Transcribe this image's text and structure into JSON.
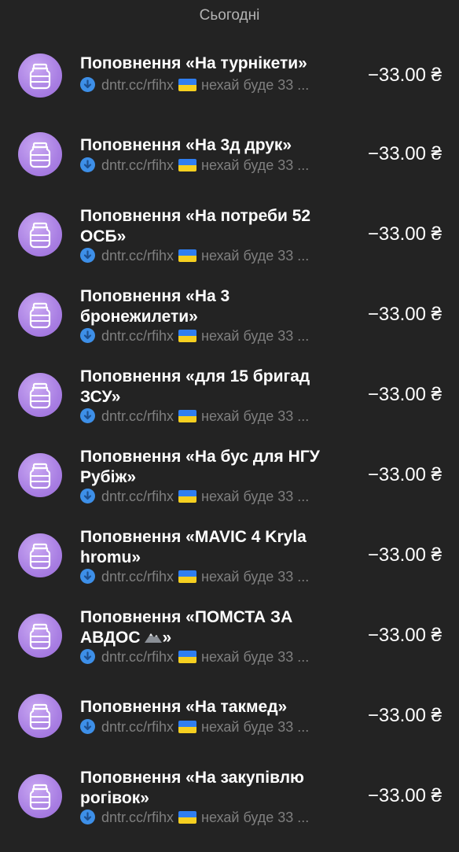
{
  "section": {
    "title": "Сьогодні"
  },
  "colors": {
    "background": "#232323",
    "avatar": "#a97fe3",
    "link_icon": "#3d8fe8",
    "flag_blue": "#2f7ef0",
    "flag_yellow": "#f5cf20"
  },
  "transactions": [
    {
      "title": "Поповнення «На турнікети»",
      "link": "dntr.cc/rfihx",
      "note": "нехай буде 33 ...",
      "amount": "−33.00 ₴",
      "icon": "jar-icon"
    },
    {
      "title": "Поповнення «На 3д друк»",
      "link": "dntr.cc/rfihx",
      "note": "нехай буде 33 ...",
      "amount": "−33.00 ₴",
      "icon": "jar-icon"
    },
    {
      "title_line1": "Поповнення «На потреби 52",
      "title_line2": "ОСБ»",
      "link": "dntr.cc/rfihx",
      "note": "нехай буде 33 ...",
      "amount": "−33.00 ₴",
      "icon": "jar-icon"
    },
    {
      "title_line1": "Поповнення «На 3",
      "title_line2": "бронежилети»",
      "link": "dntr.cc/rfihx",
      "note": "нехай буде 33 ...",
      "amount": "−33.00 ₴",
      "icon": "jar-icon"
    },
    {
      "title_line1": "Поповнення «для 15 бригад",
      "title_line2": "ЗСУ»",
      "link": "dntr.cc/rfihx",
      "note": "нехай буде 33 ...",
      "amount": "−33.00 ₴",
      "icon": "jar-icon"
    },
    {
      "title_line1": "Поповнення «На бус для НГУ",
      "title_line2": "Рубіж»",
      "link": "dntr.cc/rfihx",
      "note": "нехай буде 33 ...",
      "amount": "−33.00 ₴",
      "icon": "jar-icon"
    },
    {
      "title_line1": "Поповнення «MAVIC 4 Kryla",
      "title_line2": "hromu»",
      "link": "dntr.cc/rfihx",
      "note": "нехай буде 33 ...",
      "amount": "−33.00 ₴",
      "icon": "jar-icon"
    },
    {
      "title_line1": "Поповнення «ПОМСТА ЗА",
      "title_line2_a": "АВДОС",
      "title_line2_b": "»",
      "title_emoji": "mountain-icon",
      "link": "dntr.cc/rfihx",
      "note": "нехай буде 33 ...",
      "amount": "−33.00 ₴",
      "icon": "jar-icon"
    },
    {
      "title": "Поповнення «На такмед»",
      "link": "dntr.cc/rfihx",
      "note": "нехай буде 33 ...",
      "amount": "−33.00 ₴",
      "icon": "jar-icon"
    },
    {
      "title_line1": "Поповнення «На закупівлю",
      "title_line2": "рогівок»",
      "link": "dntr.cc/rfihx",
      "note": "нехай буде 33 ...",
      "amount": "−33.00 ₴",
      "icon": "jar-icon"
    }
  ]
}
